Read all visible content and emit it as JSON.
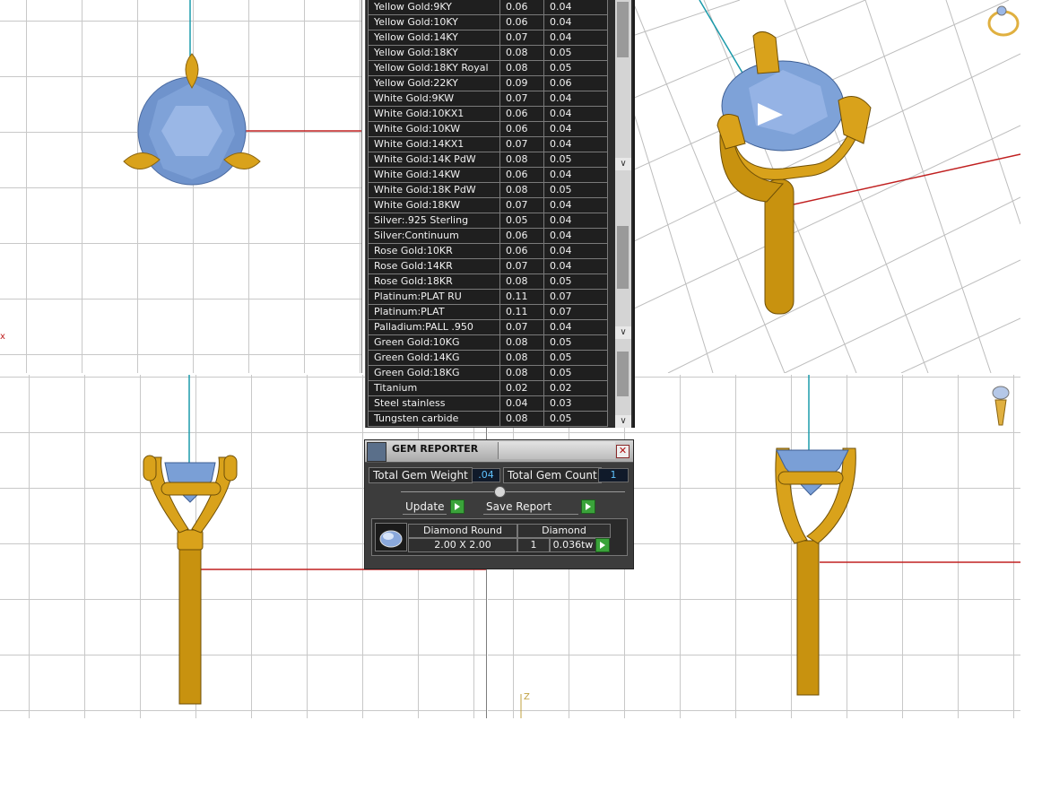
{
  "metals": {
    "rows": [
      {
        "name": "Yellow Gold:9KY",
        "a": "0.06",
        "b": "0.04"
      },
      {
        "name": "Yellow Gold:10KY",
        "a": "0.06",
        "b": "0.04"
      },
      {
        "name": "Yellow Gold:14KY",
        "a": "0.07",
        "b": "0.04"
      },
      {
        "name": "Yellow Gold:18KY",
        "a": "0.08",
        "b": "0.05"
      },
      {
        "name": "Yellow Gold:18KY Royal",
        "a": "0.08",
        "b": "0.05"
      },
      {
        "name": "Yellow Gold:22KY",
        "a": "0.09",
        "b": "0.06"
      },
      {
        "name": "White Gold:9KW",
        "a": "0.07",
        "b": "0.04"
      },
      {
        "name": "White Gold:10KX1",
        "a": "0.06",
        "b": "0.04"
      },
      {
        "name": "White Gold:10KW",
        "a": "0.06",
        "b": "0.04"
      },
      {
        "name": "White Gold:14KX1",
        "a": "0.07",
        "b": "0.04"
      },
      {
        "name": "White Gold:14K PdW",
        "a": "0.08",
        "b": "0.05"
      },
      {
        "name": "White Gold:14KW",
        "a": "0.06",
        "b": "0.04"
      },
      {
        "name": "White Gold:18K PdW",
        "a": "0.08",
        "b": "0.05"
      },
      {
        "name": "White Gold:18KW",
        "a": "0.07",
        "b": "0.04"
      },
      {
        "name": "Silver:.925 Sterling",
        "a": "0.05",
        "b": "0.04"
      },
      {
        "name": "Silver:Continuum",
        "a": "0.06",
        "b": "0.04"
      },
      {
        "name": "Rose Gold:10KR",
        "a": "0.06",
        "b": "0.04"
      },
      {
        "name": "Rose Gold:14KR",
        "a": "0.07",
        "b": "0.04"
      },
      {
        "name": "Rose Gold:18KR",
        "a": "0.08",
        "b": "0.05"
      },
      {
        "name": "Platinum:PLAT RU",
        "a": "0.11",
        "b": "0.07"
      },
      {
        "name": "Platinum:PLAT",
        "a": "0.11",
        "b": "0.07"
      },
      {
        "name": "Palladium:PALL .950",
        "a": "0.07",
        "b": "0.04"
      },
      {
        "name": "Green Gold:10KG",
        "a": "0.08",
        "b": "0.05"
      },
      {
        "name": "Green Gold:14KG",
        "a": "0.08",
        "b": "0.05"
      },
      {
        "name": "Green Gold:18KG",
        "a": "0.08",
        "b": "0.05"
      },
      {
        "name": "Titanium",
        "a": "0.02",
        "b": "0.02"
      },
      {
        "name": "Steel stainless",
        "a": "0.04",
        "b": "0.03"
      },
      {
        "name": "Tungsten carbide",
        "a": "0.08",
        "b": "0.05"
      }
    ],
    "scroll_arrow_icon": "chevron-down-icon"
  },
  "gem_reporter": {
    "title": "GEM REPORTER",
    "close_icon": "close-icon",
    "total_weight_label": "Total Gem Weight",
    "total_weight_value": ".04",
    "total_count_label": "Total Gem Count",
    "total_count_value": "1",
    "update_label": "Update",
    "save_report_label": "Save Report",
    "gem": {
      "shape": "Diamond Round",
      "size": "2.00 X 2.00",
      "material": "Diamond",
      "count": "1",
      "weight": "0.036tw"
    }
  },
  "viewports": {
    "front_axis_label": "Z",
    "top_axis_label": "x"
  },
  "colors": {
    "metal_gold": "#d9a21b",
    "gem_blue": "#7a9fd6",
    "axis_red": "#c02020",
    "axis_cyan": "#1a9aaa"
  }
}
